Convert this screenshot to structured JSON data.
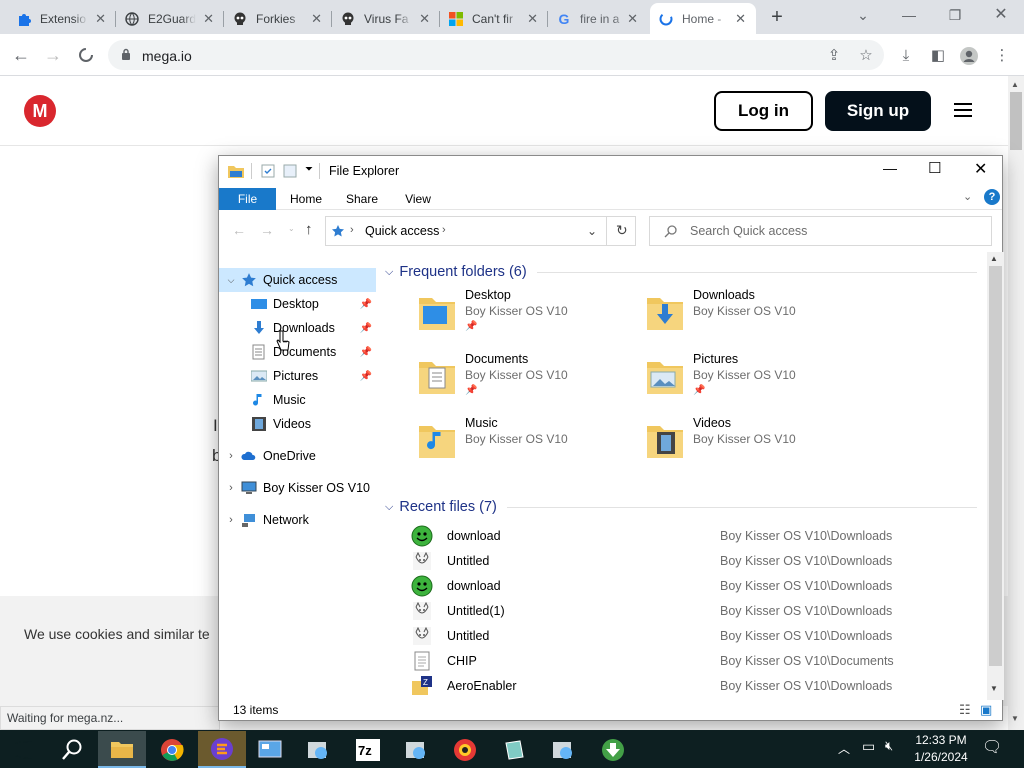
{
  "browser": {
    "tabs": [
      {
        "title": "Extensio",
        "icon": "puzzle-icon"
      },
      {
        "title": "E2Guard",
        "icon": "globe-icon"
      },
      {
        "title": "Forkies",
        "icon": "skull-icon"
      },
      {
        "title": "Virus Fa",
        "icon": "skull-icon"
      },
      {
        "title": "Can't fir",
        "icon": "microsoft-icon"
      },
      {
        "title": "fire in a",
        "icon": "google-icon"
      },
      {
        "title": "Home -",
        "icon": "loading-icon"
      }
    ],
    "url": "mega.io",
    "status_text": "Waiting for mega.nz..."
  },
  "page": {
    "login_label": "Log in",
    "signup_label": "Sign up",
    "cookie_text": "We use cookies and similar te",
    "left_fragments": [
      "I",
      "b"
    ],
    "brand_color": "#d9272e"
  },
  "explorer": {
    "title": "File Explorer",
    "ribbon_tabs": [
      "File",
      "Home",
      "Share",
      "View"
    ],
    "breadcrumb": "Quick access",
    "search_placeholder": "Search Quick access",
    "nav": {
      "quick_access": "Quick access",
      "pinned": [
        "Desktop",
        "Downloads",
        "Documents",
        "Pictures",
        "Music",
        "Videos"
      ],
      "roots": [
        "OneDrive",
        "Boy Kisser OS V10",
        "Network"
      ]
    },
    "frequent_header": "Frequent folders (6)",
    "frequent": [
      {
        "name": "Desktop",
        "location": "Boy Kisser OS V10",
        "pinned": true
      },
      {
        "name": "Downloads",
        "location": "Boy Kisser OS V10",
        "pinned": false
      },
      {
        "name": "Documents",
        "location": "Boy Kisser OS V10",
        "pinned": true
      },
      {
        "name": "Pictures",
        "location": "Boy Kisser OS V10",
        "pinned": true
      },
      {
        "name": "Music",
        "location": "Boy Kisser OS V10",
        "pinned": false
      },
      {
        "name": "Videos",
        "location": "Boy Kisser OS V10",
        "pinned": false
      }
    ],
    "recent_header": "Recent files (7)",
    "recent": [
      {
        "name": "download",
        "path": "Boy Kisser OS V10\\Downloads",
        "icon": "green-smiley-icon"
      },
      {
        "name": "Untitled",
        "path": "Boy Kisser OS V10\\Downloads",
        "icon": "cat-drawing-icon"
      },
      {
        "name": "download",
        "path": "Boy Kisser OS V10\\Downloads",
        "icon": "green-smiley-icon"
      },
      {
        "name": "Untitled(1)",
        "path": "Boy Kisser OS V10\\Downloads",
        "icon": "cat-drawing-icon"
      },
      {
        "name": "Untitled",
        "path": "Boy Kisser OS V10\\Downloads",
        "icon": "cat-drawing-icon"
      },
      {
        "name": "CHIP",
        "path": "Boy Kisser OS V10\\Documents",
        "icon": "text-file-icon"
      },
      {
        "name": "AeroEnabler",
        "path": "Boy Kisser OS V10\\Downloads",
        "icon": "app-icon"
      }
    ],
    "item_count": "13 items"
  },
  "taskbar": {
    "time": "12:33 PM",
    "date": "1/26/2024"
  }
}
